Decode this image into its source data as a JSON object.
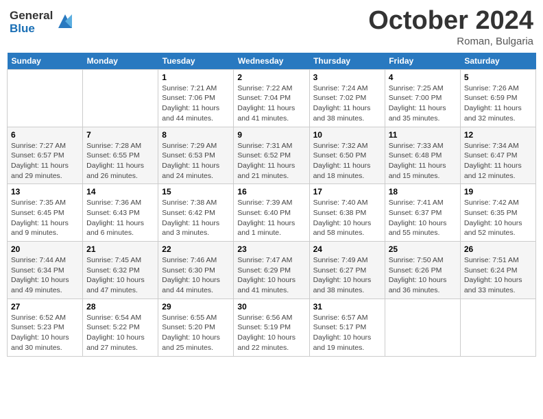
{
  "header": {
    "logo_general": "General",
    "logo_blue": "Blue",
    "month_title": "October 2024",
    "location": "Roman, Bulgaria"
  },
  "days_of_week": [
    "Sunday",
    "Monday",
    "Tuesday",
    "Wednesday",
    "Thursday",
    "Friday",
    "Saturday"
  ],
  "weeks": [
    [
      {
        "day": "",
        "details": ""
      },
      {
        "day": "",
        "details": ""
      },
      {
        "day": "1",
        "details": "Sunrise: 7:21 AM\nSunset: 7:06 PM\nDaylight: 11 hours and 44 minutes."
      },
      {
        "day": "2",
        "details": "Sunrise: 7:22 AM\nSunset: 7:04 PM\nDaylight: 11 hours and 41 minutes."
      },
      {
        "day": "3",
        "details": "Sunrise: 7:24 AM\nSunset: 7:02 PM\nDaylight: 11 hours and 38 minutes."
      },
      {
        "day": "4",
        "details": "Sunrise: 7:25 AM\nSunset: 7:00 PM\nDaylight: 11 hours and 35 minutes."
      },
      {
        "day": "5",
        "details": "Sunrise: 7:26 AM\nSunset: 6:59 PM\nDaylight: 11 hours and 32 minutes."
      }
    ],
    [
      {
        "day": "6",
        "details": "Sunrise: 7:27 AM\nSunset: 6:57 PM\nDaylight: 11 hours and 29 minutes."
      },
      {
        "day": "7",
        "details": "Sunrise: 7:28 AM\nSunset: 6:55 PM\nDaylight: 11 hours and 26 minutes."
      },
      {
        "day": "8",
        "details": "Sunrise: 7:29 AM\nSunset: 6:53 PM\nDaylight: 11 hours and 24 minutes."
      },
      {
        "day": "9",
        "details": "Sunrise: 7:31 AM\nSunset: 6:52 PM\nDaylight: 11 hours and 21 minutes."
      },
      {
        "day": "10",
        "details": "Sunrise: 7:32 AM\nSunset: 6:50 PM\nDaylight: 11 hours and 18 minutes."
      },
      {
        "day": "11",
        "details": "Sunrise: 7:33 AM\nSunset: 6:48 PM\nDaylight: 11 hours and 15 minutes."
      },
      {
        "day": "12",
        "details": "Sunrise: 7:34 AM\nSunset: 6:47 PM\nDaylight: 11 hours and 12 minutes."
      }
    ],
    [
      {
        "day": "13",
        "details": "Sunrise: 7:35 AM\nSunset: 6:45 PM\nDaylight: 11 hours and 9 minutes."
      },
      {
        "day": "14",
        "details": "Sunrise: 7:36 AM\nSunset: 6:43 PM\nDaylight: 11 hours and 6 minutes."
      },
      {
        "day": "15",
        "details": "Sunrise: 7:38 AM\nSunset: 6:42 PM\nDaylight: 11 hours and 3 minutes."
      },
      {
        "day": "16",
        "details": "Sunrise: 7:39 AM\nSunset: 6:40 PM\nDaylight: 11 hours and 1 minute."
      },
      {
        "day": "17",
        "details": "Sunrise: 7:40 AM\nSunset: 6:38 PM\nDaylight: 10 hours and 58 minutes."
      },
      {
        "day": "18",
        "details": "Sunrise: 7:41 AM\nSunset: 6:37 PM\nDaylight: 10 hours and 55 minutes."
      },
      {
        "day": "19",
        "details": "Sunrise: 7:42 AM\nSunset: 6:35 PM\nDaylight: 10 hours and 52 minutes."
      }
    ],
    [
      {
        "day": "20",
        "details": "Sunrise: 7:44 AM\nSunset: 6:34 PM\nDaylight: 10 hours and 49 minutes."
      },
      {
        "day": "21",
        "details": "Sunrise: 7:45 AM\nSunset: 6:32 PM\nDaylight: 10 hours and 47 minutes."
      },
      {
        "day": "22",
        "details": "Sunrise: 7:46 AM\nSunset: 6:30 PM\nDaylight: 10 hours and 44 minutes."
      },
      {
        "day": "23",
        "details": "Sunrise: 7:47 AM\nSunset: 6:29 PM\nDaylight: 10 hours and 41 minutes."
      },
      {
        "day": "24",
        "details": "Sunrise: 7:49 AM\nSunset: 6:27 PM\nDaylight: 10 hours and 38 minutes."
      },
      {
        "day": "25",
        "details": "Sunrise: 7:50 AM\nSunset: 6:26 PM\nDaylight: 10 hours and 36 minutes."
      },
      {
        "day": "26",
        "details": "Sunrise: 7:51 AM\nSunset: 6:24 PM\nDaylight: 10 hours and 33 minutes."
      }
    ],
    [
      {
        "day": "27",
        "details": "Sunrise: 6:52 AM\nSunset: 5:23 PM\nDaylight: 10 hours and 30 minutes."
      },
      {
        "day": "28",
        "details": "Sunrise: 6:54 AM\nSunset: 5:22 PM\nDaylight: 10 hours and 27 minutes."
      },
      {
        "day": "29",
        "details": "Sunrise: 6:55 AM\nSunset: 5:20 PM\nDaylight: 10 hours and 25 minutes."
      },
      {
        "day": "30",
        "details": "Sunrise: 6:56 AM\nSunset: 5:19 PM\nDaylight: 10 hours and 22 minutes."
      },
      {
        "day": "31",
        "details": "Sunrise: 6:57 AM\nSunset: 5:17 PM\nDaylight: 10 hours and 19 minutes."
      },
      {
        "day": "",
        "details": ""
      },
      {
        "day": "",
        "details": ""
      }
    ]
  ]
}
